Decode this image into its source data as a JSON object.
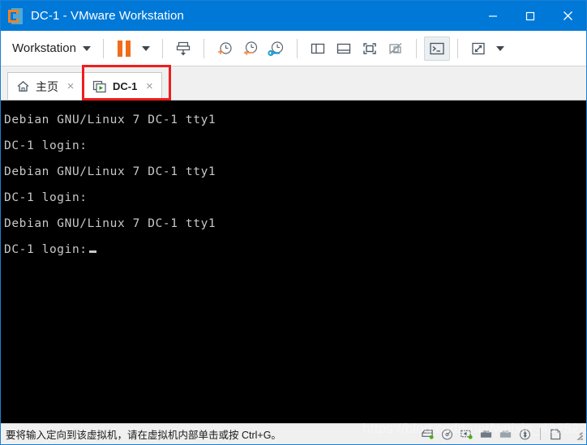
{
  "window": {
    "title": "DC-1 - VMware Workstation",
    "logo_icon": "vmware-logo-icon",
    "controls": {
      "minimize": "minimize-icon",
      "maximize": "maximize-icon",
      "close": "close-icon"
    }
  },
  "toolbar": {
    "workstation_menu": "Workstation",
    "items": [
      {
        "name": "workstation-menu-dropdown-icon",
        "icon": "chevron-down-icon"
      },
      {
        "name": "pause-vm-button",
        "icon": "pause-icon"
      },
      {
        "name": "power-dropdown-button",
        "icon": "chevron-down-icon"
      },
      {
        "name": "take-snapshot-button",
        "icon": "take-snapshot-icon"
      },
      {
        "name": "snapshot-new-button",
        "icon": "snapshot-add-clock-icon"
      },
      {
        "name": "revert-snapshot-button",
        "icon": "snapshot-revert-clock-icon"
      },
      {
        "name": "snapshot-manager-button",
        "icon": "snapshot-manager-clock-wrench-icon"
      },
      {
        "name": "show-library-button",
        "icon": "side-panel-icon"
      },
      {
        "name": "show-thumbnail-bar-button",
        "icon": "bottom-panel-icon"
      },
      {
        "name": "enter-fullscreen-button",
        "icon": "fullscreen-icon"
      },
      {
        "name": "unity-mode-button",
        "icon": "unity-disabled-icon"
      },
      {
        "name": "console-view-button",
        "icon": "console-prompt-icon",
        "active": true
      },
      {
        "name": "stretch-guest-button",
        "icon": "expand-arrows-icon"
      },
      {
        "name": "stretch-dropdown-button",
        "icon": "chevron-down-icon"
      }
    ]
  },
  "tabs": [
    {
      "label": "主页",
      "icon": "home-icon",
      "close": "×",
      "active": false
    },
    {
      "label": "DC-1",
      "icon": "virtual-machine-running-icon",
      "close": "×",
      "active": true,
      "highlighted": true
    }
  ],
  "console": {
    "lines": [
      "Debian GNU/Linux 7 DC-1 tty1",
      "",
      "DC-1 login:",
      "",
      "Debian GNU/Linux 7 DC-1 tty1",
      "",
      "DC-1 login:",
      "",
      "Debian GNU/Linux 7 DC-1 tty1",
      "",
      "DC-1 login:"
    ],
    "prompt_with_cursor": "DC-1 login:",
    "text_color": "#c8c8c8",
    "background_color": "#000000"
  },
  "statusbar": {
    "message": "要将输入定向到该虚拟机，请在虚拟机内部单击或按 Ctrl+G。",
    "devices": [
      {
        "name": "hard-disk-icon"
      },
      {
        "name": "cd-dvd-icon"
      },
      {
        "name": "network-adapter-icon"
      },
      {
        "name": "usb-device-icon"
      },
      {
        "name": "sound-card-icon"
      },
      {
        "name": "bluetooth-icon"
      },
      {
        "name": "printer-icon"
      }
    ],
    "resize_grip": "resize-grip-icon"
  },
  "overlay": {
    "watermark": "https://blog.csdn.net/weixin_43252204"
  },
  "colors": {
    "titlebar": "#0078d7",
    "accent_orange": "#ef6c1a",
    "highlight_red": "#ef1d1d",
    "console_bg": "#000000"
  }
}
